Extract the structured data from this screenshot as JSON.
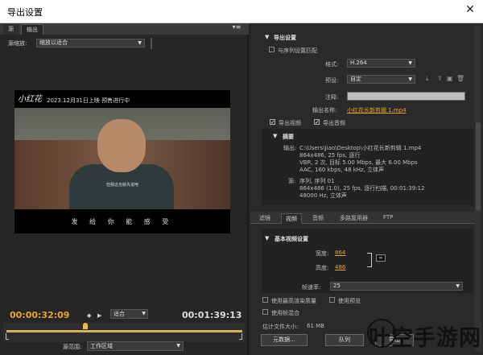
{
  "window": {
    "title": "导出设置",
    "close_glyph": "✕"
  },
  "left": {
    "tabs": [
      "源",
      "输出"
    ],
    "panel_menu_glyph": "▾≡",
    "source_scale_label": "源缩放:",
    "source_scale_value": "缩放以适合",
    "video": {
      "logo_text": "小红花",
      "promo_text": "2023.12月31日上映 预售进行中",
      "subtitle_small": "但我这也就先说吧",
      "subtitle_main": "发 给 你 能 感 受"
    },
    "timecode_current": "00:00:32:09",
    "timecode_end": "00:01:39:13",
    "mark_in": "◆",
    "mark_out": "▶",
    "fit_value": "适合",
    "source_range_label": "源范围:",
    "source_range_value": "工作区域"
  },
  "right": {
    "export_settings_title": "导出设置",
    "match_sequence_label": "与序列设置匹配",
    "format_label": "格式:",
    "format_value": "H.264",
    "preset_label": "预设:",
    "preset_value": "自定",
    "notes_label": "注释:",
    "output_name_label": "输出名称:",
    "output_name_value": "小红花长新剪辑 1.mp4",
    "export_video_label": "导出视频",
    "export_audio_label": "导出音频",
    "summary_title": "摘要",
    "output_label": "输出:",
    "output_lines": [
      "C:\\Users\\Jiao\\Desktop\\小红花长新剪辑 1.mp4",
      "864x486, 25 fps, 逐行",
      "VBR, 2 次, 目标 5.00 Mbps, 最大 6.00 Mbps",
      "AAC, 160 kbps, 48 kHz, 立体声"
    ],
    "source_label": "源:",
    "source_lines": [
      "序列, 序列 01",
      "864x486 (1.0), 25 fps, 逐行扫描, 00:01:39:12",
      "48000 Hz, 立体声"
    ],
    "tabs": [
      "滤镜",
      "视频",
      "音频",
      "多路复用器",
      "FTP"
    ],
    "active_tab": "视频",
    "basic_video_title": "基本视频设置",
    "width_label": "宽度:",
    "width_value": "864",
    "height_label": "高度:",
    "height_value": "486",
    "frame_rate_label": "帧速率:",
    "frame_rate_value": "25",
    "max_render_label": "使用最高渲染质量",
    "use_preview_label": "使用预览",
    "use_frame_blend_label": "使用帧混合",
    "est_size_label": "估计文件大小:",
    "est_size_value": "61 MB",
    "meta_button": "元数据...",
    "queue_button": "队列",
    "export_button": "导出"
  },
  "watermark": "叶空手游网"
}
